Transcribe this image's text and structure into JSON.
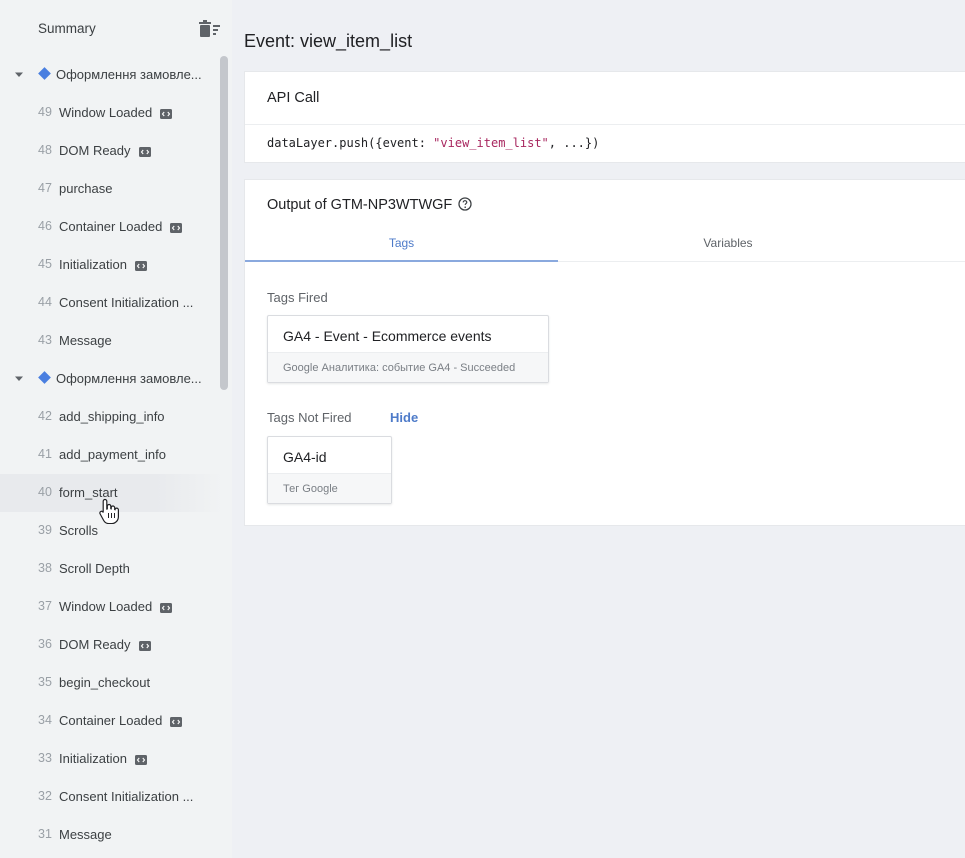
{
  "sidebar": {
    "title": "Summary",
    "groups": [
      {
        "label": "Оформлення замовле...",
        "events": [
          {
            "num": "49",
            "label": "Window Loaded",
            "icon": "code-icon"
          },
          {
            "num": "48",
            "label": "DOM Ready",
            "icon": "code-icon"
          },
          {
            "num": "47",
            "label": "purchase",
            "icon": ""
          },
          {
            "num": "46",
            "label": "Container Loaded",
            "icon": "code-icon"
          },
          {
            "num": "45",
            "label": "Initialization",
            "icon": "code-icon"
          },
          {
            "num": "44",
            "label": "Consent Initialization ...",
            "icon": ""
          },
          {
            "num": "43",
            "label": "Message",
            "icon": ""
          }
        ]
      },
      {
        "label": "Оформлення замовле...",
        "events": [
          {
            "num": "42",
            "label": "add_shipping_info",
            "icon": ""
          },
          {
            "num": "41",
            "label": "add_payment_info",
            "icon": ""
          },
          {
            "num": "40",
            "label": "form_start",
            "icon": ""
          },
          {
            "num": "39",
            "label": "Scrolls",
            "icon": ""
          },
          {
            "num": "38",
            "label": "Scroll Depth",
            "icon": ""
          },
          {
            "num": "37",
            "label": "Window Loaded",
            "icon": "code-icon"
          },
          {
            "num": "36",
            "label": "DOM Ready",
            "icon": "code-icon"
          },
          {
            "num": "35",
            "label": "begin_checkout",
            "icon": ""
          },
          {
            "num": "34",
            "label": "Container Loaded",
            "icon": "code-icon"
          },
          {
            "num": "33",
            "label": "Initialization",
            "icon": "code-icon"
          },
          {
            "num": "32",
            "label": "Consent Initialization ...",
            "icon": ""
          },
          {
            "num": "31",
            "label": "Message",
            "icon": ""
          }
        ]
      }
    ]
  },
  "main": {
    "title": "Event: view_item_list",
    "api_call": {
      "title": "API Call",
      "code_prefix": "dataLayer.push({event: ",
      "code_string": "\"view_item_list\"",
      "code_suffix": ", ...})"
    },
    "output": {
      "title": "Output of GTM-NP3WTWGF",
      "tabs": {
        "tags": "Tags",
        "variables": "Variables"
      },
      "fired_label": "Tags Fired",
      "fired_tags": [
        {
          "name": "GA4 - Event - Ecommerce events",
          "sub": "Google Аналитика: событие GA4 - Succeeded"
        }
      ],
      "not_fired_label": "Tags Not Fired",
      "hide_label": "Hide",
      "not_fired_tags": [
        {
          "name": "GA4-id",
          "sub": "Тег Google"
        }
      ]
    }
  },
  "colors": {
    "accent": "#4e7bc9",
    "diamond": "#4a7fe0"
  }
}
